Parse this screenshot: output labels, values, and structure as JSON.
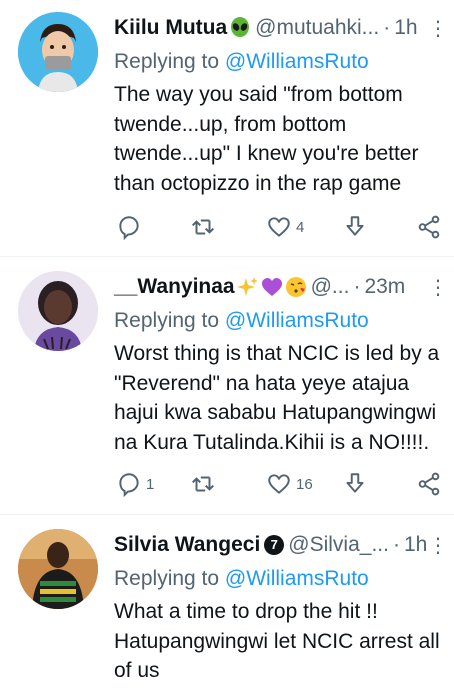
{
  "tweets": [
    {
      "name": "Kiilu Mutua",
      "handle": "@mutuahki...",
      "time": "1h",
      "reply_prefix": "Replying to",
      "reply_to": "@WilliamsRuto",
      "text": "The way you said \"from bottom twende...up, from bottom twende...up\" I knew you're better than octopizzo in the rap game",
      "counts": {
        "reply": "",
        "retweet": "",
        "like": "4"
      },
      "name_emojis": [
        "alien-emoji"
      ]
    },
    {
      "name": "__Wanyinaa",
      "handle": "@...",
      "time": "23m",
      "reply_prefix": "Replying to",
      "reply_to": "@WilliamsRuto",
      "text": "Worst thing is that NCIC is led by a \"Reverend\" na hata yeye atajua hajui kwa sababu Hatupangwingwi na Kura Tutalinda.Kihii is a NO!!!!.",
      "counts": {
        "reply": "1",
        "retweet": "",
        "like": "16"
      },
      "name_emojis": [
        "sparkles-emoji",
        "purple-heart-emoji",
        "kiss-face-emoji"
      ]
    },
    {
      "name": "Silvia Wangeci",
      "badge": "7",
      "handle": "@Silvia_...",
      "time": "1h",
      "reply_prefix": "Replying to",
      "reply_to": "@WilliamsRuto",
      "text": "What a time to drop the hit !! Hatupangwingwi let NCIC arrest all of us",
      "counts": {
        "reply": "",
        "retweet": "",
        "like": ""
      },
      "name_emojis": []
    }
  ],
  "colors": {
    "link": "#1d9bf0",
    "muted": "#536471",
    "text": "#0f1419",
    "divider": "#eff3f4"
  }
}
